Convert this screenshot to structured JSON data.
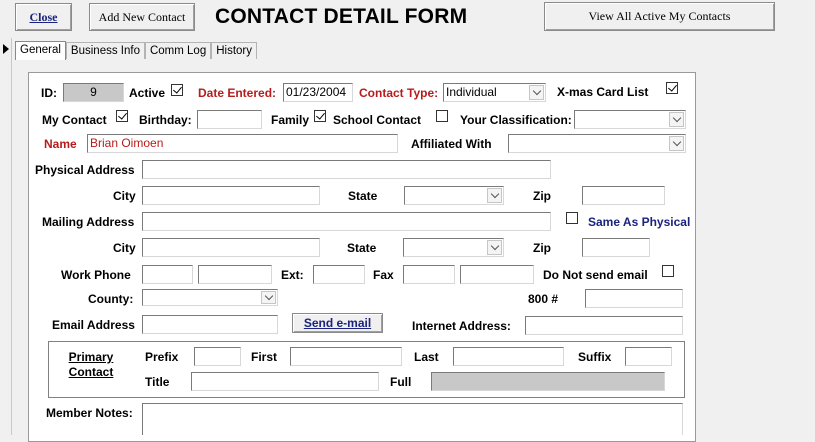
{
  "toolbar": {
    "close_label": "Close",
    "add_label": "Add New Contact",
    "view_all_label": "View All Active My Contacts"
  },
  "form_title": "CONTACT DETAIL FORM",
  "tabs": [
    {
      "label": "General",
      "active": true
    },
    {
      "label": "Business Info",
      "active": false
    },
    {
      "label": "Comm Log",
      "active": false
    },
    {
      "label": "History",
      "active": false
    }
  ],
  "labels": {
    "id": "ID:",
    "active": "Active",
    "date_entered": "Date Entered:",
    "contact_type": "Contact Type:",
    "xmas": "X-mas Card List",
    "my_contact": "My Contact",
    "birthday": "Birthday:",
    "family": "Family",
    "school_contact": "School Contact",
    "your_classification": "Your Classification:",
    "name": "Name",
    "affiliated_with": "Affiliated With",
    "physical_address": "Physical Address",
    "city": "City",
    "state": "State",
    "zip": "Zip",
    "mailing_address": "Mailing Address",
    "same_as_physical": "Same As Physical",
    "work_phone": "Work Phone",
    "ext": "Ext:",
    "fax": "Fax",
    "do_not_send_email": "Do Not send email",
    "county": "County:",
    "num_800": "800 #",
    "email_address": "Email Address",
    "send_email": "Send e-mail",
    "internet_address": "Internet Address:",
    "primary_contact": "Primary Contact",
    "prefix": "Prefix",
    "first": "First",
    "last": "Last",
    "suffix": "Suffix",
    "title": "Title",
    "full": "Full",
    "member_notes": "Member Notes:"
  },
  "values": {
    "id": "9",
    "date_entered": "01/23/2004",
    "contact_type": "Individual",
    "name": "Brian Oimoen"
  },
  "checks": {
    "active": true,
    "xmas": true,
    "my_contact": true,
    "family": true,
    "school_contact": false,
    "same_as_physical": false,
    "do_not_send_email": false
  },
  "colors": {
    "label_red": "#b71c1c",
    "label_blue": "#1a237e"
  }
}
